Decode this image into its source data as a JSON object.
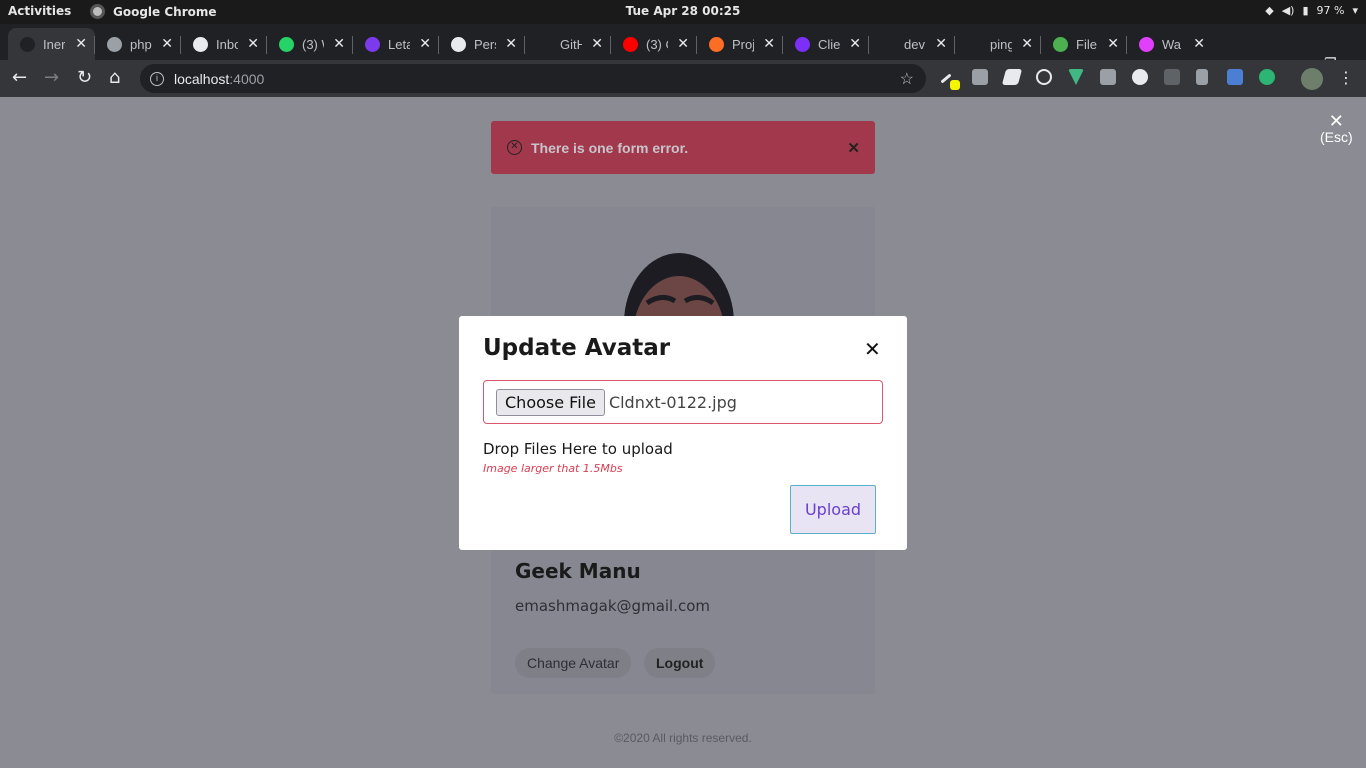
{
  "topbar": {
    "activities": "Activities",
    "app": "Google Chrome",
    "clock": "Tue Apr 28  00:25",
    "battery": "97 %"
  },
  "tabs": [
    {
      "title": "Iner",
      "color": "#202124"
    },
    {
      "title": "php",
      "color": "#9aa0a6"
    },
    {
      "title": "Inbox",
      "color": "#e8eaed"
    },
    {
      "title": "(3) W",
      "color": "#25d366"
    },
    {
      "title": "Leta",
      "color": "#7c3aed"
    },
    {
      "title": "Pers",
      "color": "#e8eaed"
    },
    {
      "title": "GitH",
      "color": "#202124"
    },
    {
      "title": "(3) C",
      "color": "#ff0000"
    },
    {
      "title": "Proj",
      "color": "#fc6d26"
    },
    {
      "title": "Clie",
      "color": "#7b2ff7"
    },
    {
      "title": "dev",
      "color": "#202124"
    },
    {
      "title": "ping",
      "color": "#202124"
    },
    {
      "title": "File",
      "color": "#4caf50"
    },
    {
      "title": "Wa",
      "color": "#e040fb"
    }
  ],
  "newtab": "+",
  "omnibox": {
    "host": "localhost",
    "port": ":4000"
  },
  "page": {
    "alert": "There is one form error.",
    "esc_label": "(Esc)",
    "profile": {
      "name": "Geek Manu",
      "email": "emashmagak@gmail.com",
      "change_avatar": "Change Avatar",
      "logout": "Logout"
    },
    "footer": "©2020 All rights reserved."
  },
  "modal": {
    "title": "Update Avatar",
    "choose_file": "Choose File",
    "file_name": "Cldnxt-0122.jpg",
    "drop_text": "Drop Files Here to upload",
    "error": "Image larger that 1.5Mbs",
    "upload": "Upload"
  }
}
